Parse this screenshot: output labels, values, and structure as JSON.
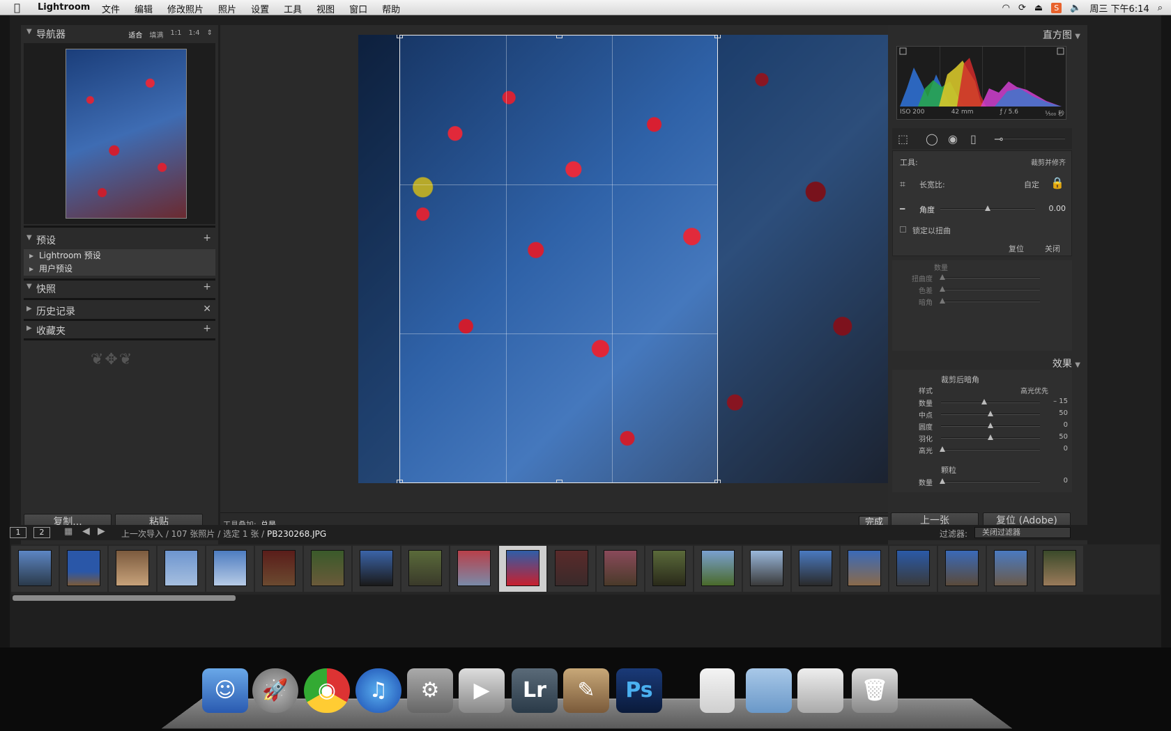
{
  "menubar": {
    "app": "Lightroom",
    "items": [
      "文件",
      "编辑",
      "修改照片",
      "照片",
      "设置",
      "工具",
      "视图",
      "窗口",
      "帮助"
    ],
    "clock": "周三 下午6:14"
  },
  "left": {
    "navigator_title": "导航器",
    "zoom_options": [
      "适合",
      "填满",
      "1:1",
      "1:4"
    ],
    "presets_title": "预设",
    "presets_items": [
      "Lightroom 预设",
      "用户预设"
    ],
    "snapshots_title": "快照",
    "history_title": "历史记录",
    "collections_title": "收藏夹",
    "copy_button": "复制...",
    "paste_button": "粘贴"
  },
  "toolbar": {
    "overlay_label": "工具叠加:",
    "overlay_value": "总是",
    "done_button": "完成"
  },
  "right": {
    "histogram_title": "直方图",
    "iso": "ISO 200",
    "focal": "42 mm",
    "aperture": "ƒ / 5.6",
    "shutter": "¹⁄₅₀₀ 秒",
    "tool_label": "工具:",
    "tool_name": "裁剪并修齐",
    "aspect_label": "长宽比:",
    "aspect_value": "自定",
    "angle_label": "角度",
    "angle_value": "0.00",
    "constrain_label": "锁定以扭曲",
    "reset_label": "复位",
    "close_label": "关闭",
    "lens_amount": "数量",
    "lens_rows": [
      "扭曲度",
      "色差",
      "暗角"
    ],
    "effects_title": "效果",
    "vignette_title": "裁剪后暗角",
    "style_label": "样式",
    "style_value": "高光优先",
    "vignette_rows": [
      {
        "label": "数量",
        "value": "– 15"
      },
      {
        "label": "中点",
        "value": "50"
      },
      {
        "label": "圆度",
        "value": "0"
      },
      {
        "label": "羽化",
        "value": "50"
      },
      {
        "label": "高光",
        "value": "0"
      }
    ],
    "grain_title": "颗粒",
    "grain_rows": [
      {
        "label": "数量",
        "value": "0"
      }
    ],
    "prev_button": "上一张",
    "reset_button": "复位 (Adobe)"
  },
  "filmbar": {
    "page1": "1",
    "page2": "2",
    "breadcrumb": "上一次导入 / 107 张照片 / 选定 1 张 /",
    "filename": "PB230268.JPG",
    "filter_label": "过滤器:",
    "filter_value": "关闭过滤器"
  },
  "dock": {
    "lr_label": "Lr",
    "ps_label": "Ps"
  }
}
